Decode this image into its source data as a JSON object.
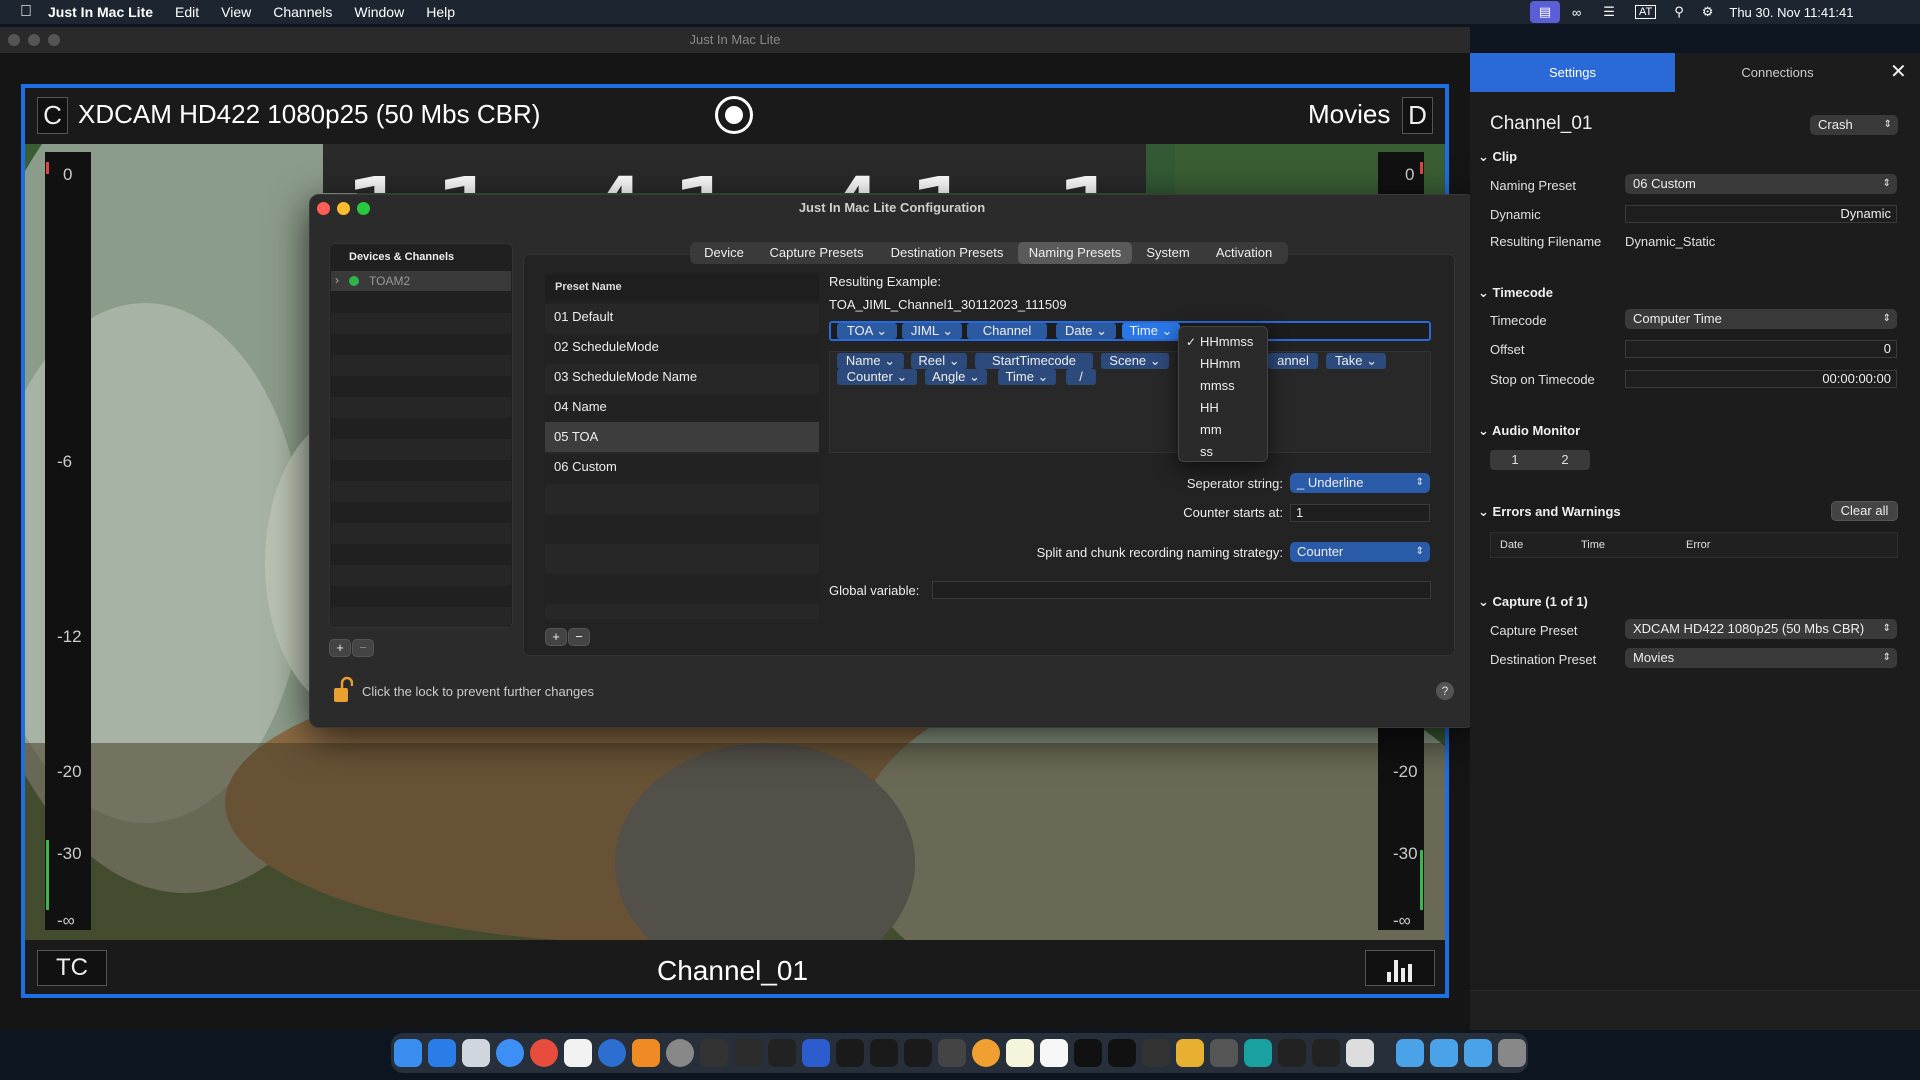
{
  "menubar": {
    "app": "Just In Mac Lite",
    "items": [
      "Edit",
      "View",
      "Channels",
      "Window",
      "Help"
    ],
    "clock": "Thu 30. Nov  11:41:41",
    "input_source": "AT"
  },
  "window": {
    "title": "Just In Mac Lite"
  },
  "video": {
    "left_box": "C",
    "preset": "XDCAM HD422 1080p25 (50 Mbs CBR)",
    "destination": "Movies",
    "right_box": "D",
    "timecode_box": "TC",
    "channel": "Channel_01",
    "meter_left_ticks": [
      "0",
      "-6",
      "-12",
      "-20",
      "-30",
      "-∞"
    ],
    "meter_right_ticks": [
      "0",
      "-20",
      "-30",
      "-∞"
    ]
  },
  "config": {
    "title": "Just In Mac Lite Configuration",
    "devices_header": "Devices & Channels",
    "device": "TOAM2",
    "tabs": [
      "Device",
      "Capture Presets",
      "Destination Presets",
      "Naming Presets",
      "System",
      "Activation"
    ],
    "active_tab": "Naming Presets",
    "preset_header": "Preset Name",
    "presets": [
      "01 Default",
      "02 ScheduleMode",
      "03 ScheduleMode Name",
      "04 Name",
      "05 TOA",
      "06 Custom"
    ],
    "selected_preset": "05 TOA",
    "resulting_label": "Resulting Example:",
    "resulting_example": "TOA_JIML_Channel1_30112023_111509",
    "tokens_row": [
      "TOA",
      "JIML",
      "Channel",
      "Date",
      "Time"
    ],
    "available_row1": [
      "Name",
      "Reel",
      "StartTimecode",
      "Scene",
      "annel",
      "Take"
    ],
    "available_row2": [
      "Counter",
      "Angle",
      "Time",
      "/"
    ],
    "separator_label": "Seperator string:",
    "separator_value": "_ Underline",
    "counter_label": "Counter starts at:",
    "counter_value": "1",
    "split_label": "Split and chunk recording naming strategy:",
    "split_value": "Counter",
    "global_label": "Global variable:",
    "global_value": "",
    "lock_text": "Click the lock to prevent further changes",
    "help": "?"
  },
  "time_menu": {
    "items": [
      "HHmmss",
      "HHmm",
      "mmss",
      "HH",
      "mm",
      "ss"
    ],
    "checked": "HHmmss"
  },
  "side": {
    "tab_settings": "Settings",
    "tab_connections": "Connections",
    "channel": "Channel_01",
    "crash": "Crash",
    "clip": {
      "head": "Clip",
      "naming_label": "Naming Preset",
      "naming_value": "06 Custom",
      "dynamic_label": "Dynamic",
      "dynamic_value": "Dynamic",
      "filename_label": "Resulting Filename",
      "filename_value": "Dynamic_Static"
    },
    "timecode": {
      "head": "Timecode",
      "tc_label": "Timecode",
      "tc_value": "Computer Time",
      "offset_label": "Offset",
      "offset_value": "0",
      "stop_label": "Stop on Timecode",
      "stop_value": "00:00:00:00"
    },
    "audio": {
      "head": "Audio Monitor",
      "ch1": "1",
      "ch2": "2"
    },
    "errors": {
      "head": "Errors and Warnings",
      "clear": "Clear all",
      "cols": [
        "Date",
        "Time",
        "Error"
      ]
    },
    "capture": {
      "head": "Capture (1 of 1)",
      "preset_label": "Capture Preset",
      "preset_value": "XDCAM HD422 1080p25 (50 Mbs CBR)",
      "dest_label": "Destination Preset",
      "dest_value": "Movies"
    }
  },
  "colors": {
    "accent": "#1e6fe6",
    "selected_tab": "#2a6ad8",
    "token": "#2c5aa0"
  }
}
